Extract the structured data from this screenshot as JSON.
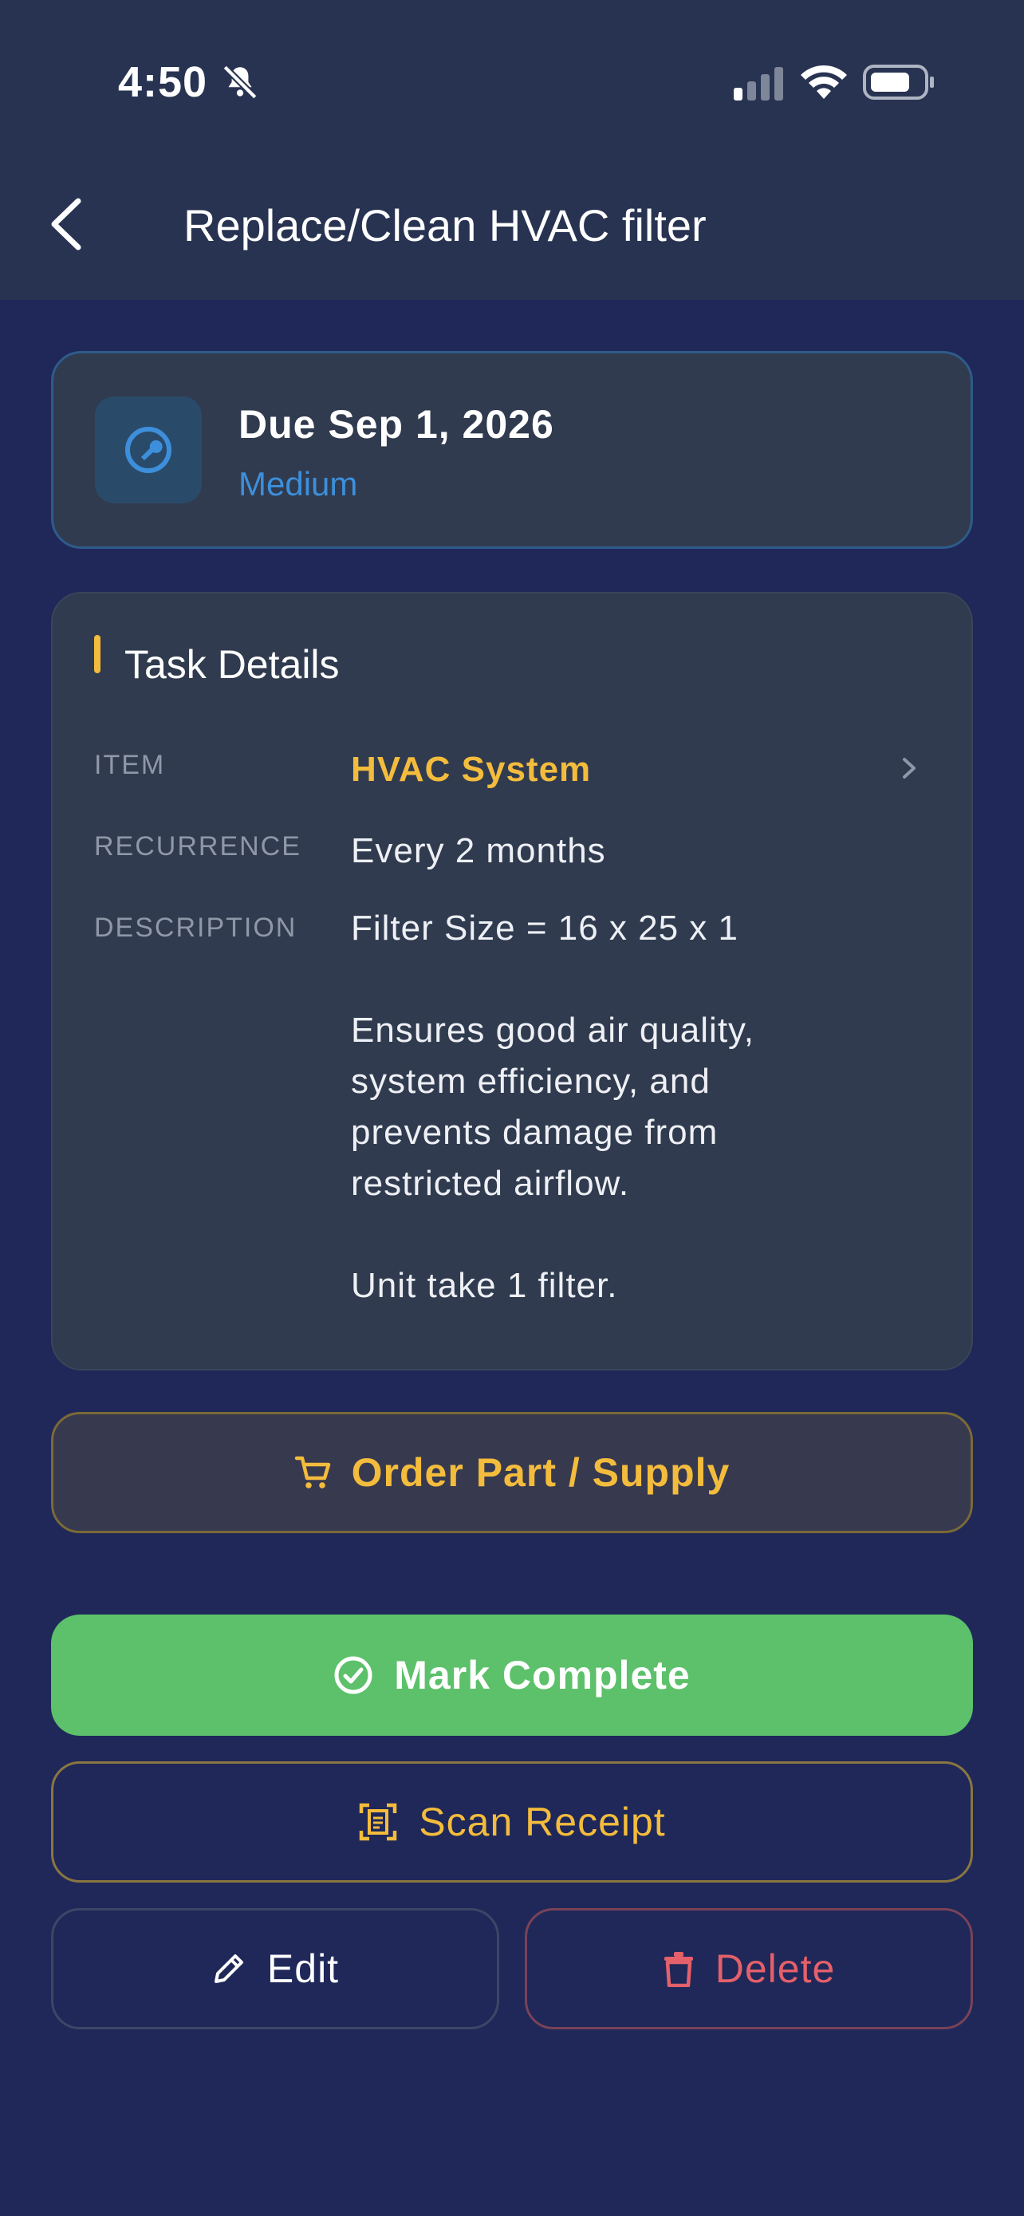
{
  "status_bar": {
    "time": "4:50"
  },
  "header": {
    "title": "Replace/Clean HVAC filter"
  },
  "due_card": {
    "due": "Due Sep 1, 2026",
    "priority": "Medium",
    "priority_color": "#3d8fdb"
  },
  "details": {
    "section_title": "Task Details",
    "item_label": "ITEM",
    "item_value": "HVAC System",
    "recurrence_label": "RECURRENCE",
    "recurrence_value": "Every 2 months",
    "description_label": "DESCRIPTION",
    "description_value": "Filter Size = 16 x 25 x 1\n\nEnsures good air quality,\nsystem efficiency, and\nprevents damage from\nrestricted airflow.\n\nUnit take 1 filter."
  },
  "actions": {
    "order": "Order Part / Supply",
    "complete": "Mark Complete",
    "scan": "Scan Receipt",
    "edit": "Edit",
    "delete": "Delete"
  },
  "colors": {
    "background": "#1f2859",
    "accent_gold": "#f4bc3c",
    "success_green": "#5cc16a",
    "danger_red": "#e4606a"
  },
  "icons": [
    "bell-slash-icon",
    "signal-icon",
    "wifi-icon",
    "battery-icon",
    "back-chevron-icon",
    "wrench-icon",
    "chevron-right-icon",
    "cart-icon",
    "check-circle-icon",
    "scan-icon",
    "pencil-icon",
    "trash-icon"
  ]
}
